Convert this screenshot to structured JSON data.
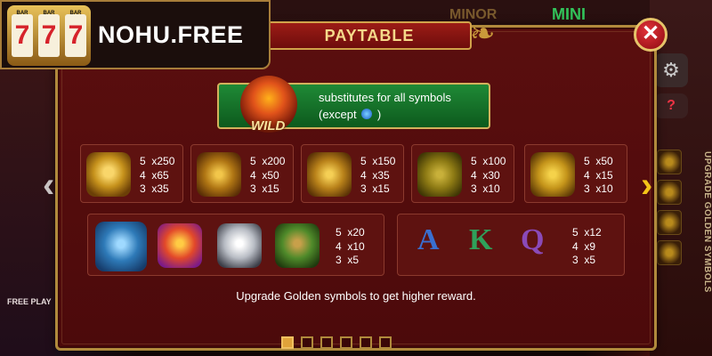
{
  "background": {
    "mini_label": "MINI",
    "minor_label": "MINOR",
    "free_play": "FREE PLAY",
    "upgrade_vertical": "UPGRADE GOLDEN SYMBOLS",
    "gear_icon": "gear-icon",
    "help_icon": "?"
  },
  "logo": {
    "text": "NOHU.FREE",
    "reels": [
      "7",
      "7",
      "7"
    ],
    "bar_labels": [
      "BAR",
      "BAR",
      "BAR"
    ]
  },
  "popup": {
    "title": "PAYTABLE",
    "close_symbol": "✕",
    "wild": {
      "label": "WILD",
      "line1": "substitutes for all symbols",
      "line2_prefix": "(except",
      "line2_suffix": ")"
    },
    "row1": [
      {
        "symbol": "golden-dragon",
        "pays": "5  x250\n4  x65\n3  x35"
      },
      {
        "symbol": "golden-phoenix",
        "pays": "5  x200\n4  x50\n3  x15"
      },
      {
        "symbol": "golden-tiger",
        "pays": "5  x150\n4  x35\n3  x15"
      },
      {
        "symbol": "golden-turtle",
        "pays": "5  x100\n4  x30\n3  x10"
      },
      {
        "symbol": "golden-koi",
        "pays": "5  x50\n4  x15\n3  x10"
      }
    ],
    "row2_animals": {
      "symbols": [
        "blue-dragon",
        "red-phoenix",
        "white-tiger",
        "green-turtle"
      ],
      "pays": "5  x20\n4  x10\n3  x5"
    },
    "row2_letters": {
      "letters": [
        "A",
        "K",
        "Q"
      ],
      "letter_colors": [
        "#3a6fd0",
        "#2fa05a",
        "#8a4ab8"
      ],
      "pays": "5  x12\n4  x9\n3  x5"
    },
    "hint": "Upgrade Golden symbols to get higher reward.",
    "nav_left": "‹",
    "nav_right": "›",
    "pages": 6,
    "active_page": 1
  }
}
